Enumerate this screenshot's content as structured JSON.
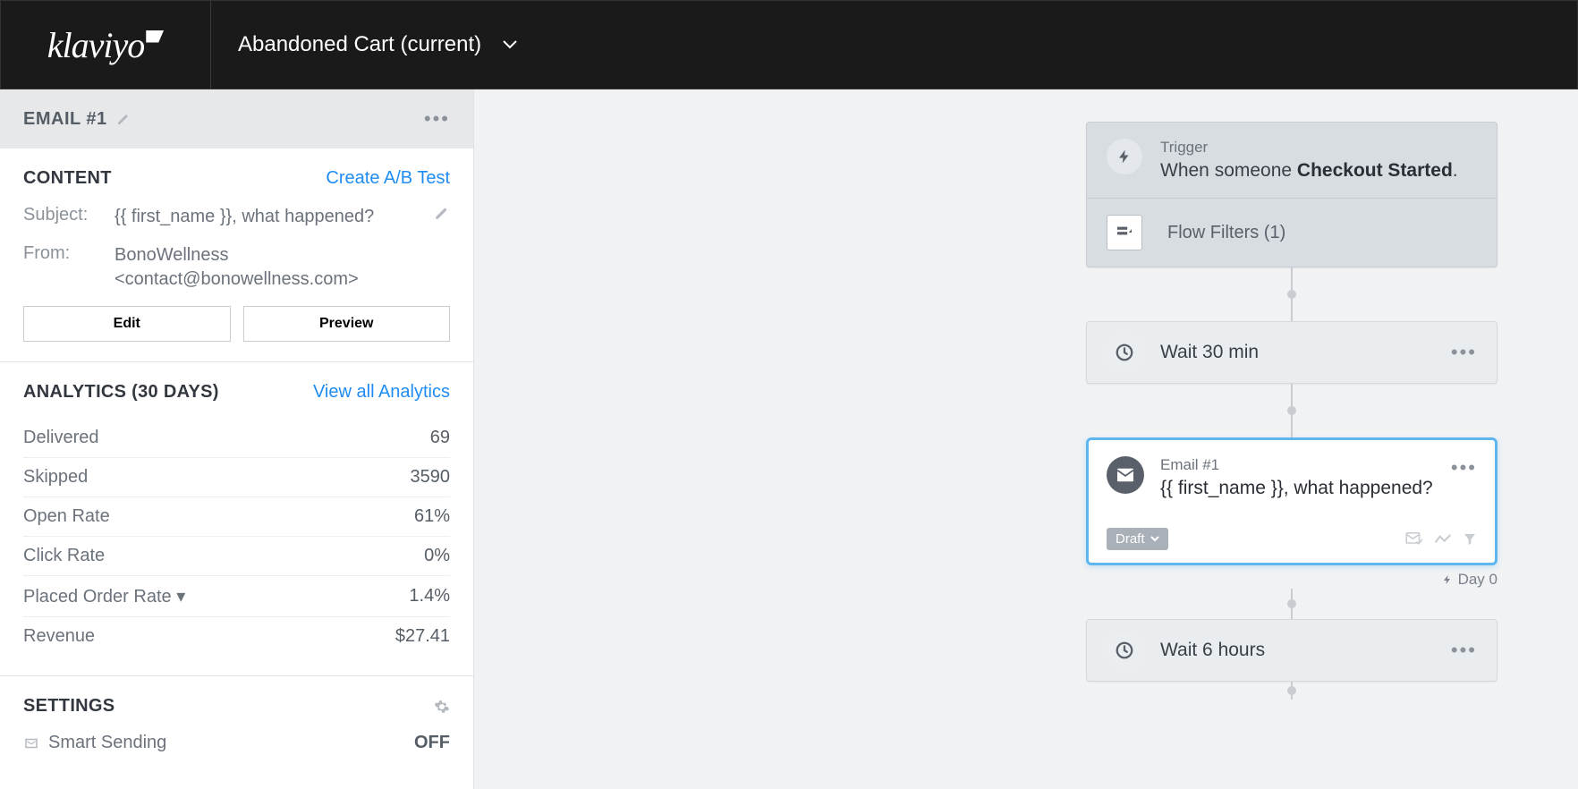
{
  "header": {
    "logo": "klaviyo",
    "flow_name": "Abandoned Cart (current)"
  },
  "sidebar": {
    "title": "EMAIL #1",
    "content": {
      "heading": "CONTENT",
      "ab_link": "Create A/B Test",
      "subject_label": "Subject:",
      "subject_value": "{{ first_name }}, what happened?",
      "from_label": "From:",
      "from_value": "BonoWellness <contact@bonowellness.com>",
      "edit_btn": "Edit",
      "preview_btn": "Preview"
    },
    "analytics": {
      "heading": "ANALYTICS (30 DAYS)",
      "link": "View all Analytics",
      "rows": [
        {
          "label": "Delivered",
          "value": "69"
        },
        {
          "label": "Skipped",
          "value": "3590"
        },
        {
          "label": "Open Rate",
          "value": "61%"
        },
        {
          "label": "Click Rate",
          "value": "0%"
        },
        {
          "label": "Placed Order Rate ▾",
          "value": "1.4%"
        },
        {
          "label": "Revenue",
          "value": "$27.41"
        }
      ]
    },
    "settings": {
      "heading": "SETTINGS",
      "smart_sending_label": "Smart Sending",
      "smart_sending_value": "OFF"
    }
  },
  "flow": {
    "trigger": {
      "label": "Trigger",
      "text_prefix": "When someone ",
      "text_bold": "Checkout Started",
      "text_suffix": ".",
      "filters_label": "Flow Filters (1)"
    },
    "wait1": "Wait 30 min",
    "email1": {
      "label": "Email #1",
      "subject": "{{ first_name }}, what happened?",
      "status": "Draft"
    },
    "day_label": "Day 0",
    "wait2": "Wait 6 hours"
  }
}
